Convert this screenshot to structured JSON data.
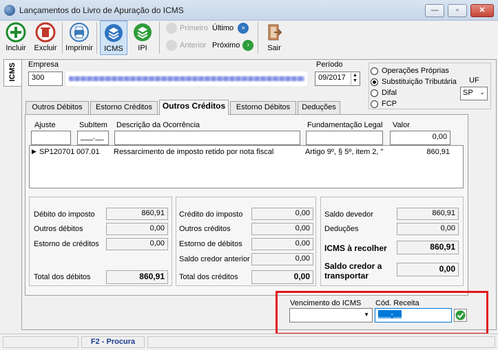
{
  "window": {
    "title": "Lançamentos do Livro de Apuração do ICMS",
    "minimize": "—",
    "maximize": "▫",
    "close": "✕"
  },
  "toolbar": {
    "incluir": "Incluir",
    "excluir": "Excluir",
    "imprimir": "Imprimir",
    "icms": "ICMS",
    "ipi": "IPI",
    "primeiro": "Primeiro",
    "ultimo": "Último",
    "anterior": "Anterior",
    "proximo": "Próximo",
    "sair": "Sair"
  },
  "side_tab": "ICMS",
  "empresa": {
    "label": "Empresa",
    "code": "300"
  },
  "periodo": {
    "label": "Período",
    "value": "09/2017"
  },
  "operacoes": {
    "options": [
      "Operações Próprias",
      "Substituição Tributária",
      "Difal",
      "FCP"
    ],
    "selected": 1,
    "uf_label": "UF",
    "uf_value": "SP"
  },
  "tabs": [
    "Outros Débitos",
    "Estorno Créditos",
    "Outros Créditos",
    "Estorno Débitos",
    "Deduções"
  ],
  "active_tab": 2,
  "entry": {
    "ajuste_label": "Ajuste",
    "subitem_label": "SubItem",
    "descricao_label": "Descrição da Ocorrência",
    "fundamentacao_label": "Fundamentação Legal",
    "valor_label": "Valor",
    "subitem_mask": "___.__",
    "valor_value": "0,00"
  },
  "rows": [
    {
      "marker": "▶",
      "ajuste": "SP120701",
      "subitem": "007.01",
      "descricao": "Ressarcimento de imposto retido por nota fiscal",
      "fundamentacao": "Artigo 9º, § 5º, item 2, \"",
      "valor": "860,91"
    }
  ],
  "debitos": {
    "debito_imposto_label": "Débito do imposto",
    "debito_imposto": "860,91",
    "outros_debitos_label": "Outros débitos",
    "outros_debitos": "0,00",
    "estorno_creditos_label": "Estorno de créditos",
    "estorno_creditos": "0,00",
    "total_label": "Total dos débitos",
    "total": "860,91"
  },
  "creditos": {
    "credito_imposto_label": "Crédito do imposto",
    "credito_imposto": "0,00",
    "outros_creditos_label": "Outros créditos",
    "outros_creditos": "0,00",
    "estorno_debitos_label": "Estorno de débitos",
    "estorno_debitos": "0,00",
    "saldo_anterior_label": "Saldo credor anterior",
    "saldo_anterior": "0,00",
    "total_label": "Total dos créditos",
    "total": "0,00"
  },
  "saldo": {
    "devedor_label": "Saldo devedor",
    "devedor": "860,91",
    "deducoes_label": "Deduções",
    "deducoes": "0,00",
    "recolher_label": "ICMS à recolher",
    "recolher": "860,91",
    "credor_label": "Saldo credor a transportar",
    "credor": "0,00"
  },
  "vencimento": {
    "label": "Vencimento do ICMS",
    "value": ""
  },
  "receita": {
    "label": "Cód. Receita",
    "mask": "___-__"
  },
  "status": {
    "hint": "F2 - Procura"
  },
  "colors": {
    "accent": "#0078d7",
    "highlight": "#e0161b",
    "nav_green": "#2e9c3a"
  }
}
